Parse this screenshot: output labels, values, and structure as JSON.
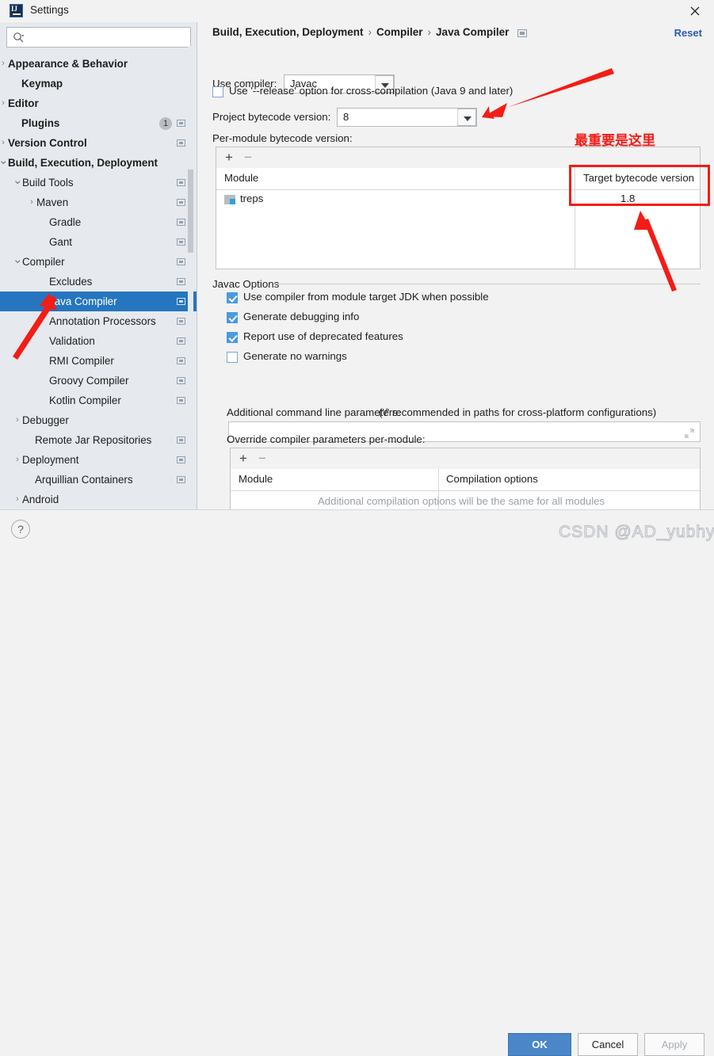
{
  "window": {
    "title": "Settings",
    "logo_icon": "intellij-idea-logo",
    "close_icon": "close-icon"
  },
  "search": {
    "value": "",
    "placeholder": "",
    "icon": "search-icon"
  },
  "sidebar": {
    "items": [
      {
        "label": "Appearance & Behavior",
        "indent": 10,
        "arrow": "chevron-right",
        "bold": true,
        "cfg": false,
        "badge": null,
        "selected": false
      },
      {
        "label": "Keymap",
        "indent": 27,
        "arrow": "",
        "bold": true,
        "cfg": false,
        "badge": null,
        "selected": false
      },
      {
        "label": "Editor",
        "indent": 10,
        "arrow": "chevron-right",
        "bold": true,
        "cfg": false,
        "badge": null,
        "selected": false
      },
      {
        "label": "Plugins",
        "indent": 27,
        "arrow": "",
        "bold": true,
        "cfg": true,
        "badge": "1",
        "selected": false
      },
      {
        "label": "Version Control",
        "indent": 10,
        "arrow": "chevron-right",
        "bold": true,
        "cfg": true,
        "badge": null,
        "selected": false
      },
      {
        "label": "Build, Execution, Deployment",
        "indent": 10,
        "arrow": "chevron-down",
        "bold": true,
        "cfg": false,
        "badge": null,
        "selected": false
      },
      {
        "label": "Build Tools",
        "indent": 28,
        "arrow": "chevron-down",
        "bold": false,
        "cfg": true,
        "badge": null,
        "selected": false
      },
      {
        "label": "Maven",
        "indent": 46,
        "arrow": "chevron-right",
        "bold": false,
        "cfg": true,
        "badge": null,
        "selected": false
      },
      {
        "label": "Gradle",
        "indent": 62,
        "arrow": "",
        "bold": false,
        "cfg": true,
        "badge": null,
        "selected": false
      },
      {
        "label": "Gant",
        "indent": 62,
        "arrow": "",
        "bold": false,
        "cfg": true,
        "badge": null,
        "selected": false
      },
      {
        "label": "Compiler",
        "indent": 28,
        "arrow": "chevron-down",
        "bold": false,
        "cfg": true,
        "badge": null,
        "selected": false
      },
      {
        "label": "Excludes",
        "indent": 62,
        "arrow": "",
        "bold": false,
        "cfg": true,
        "badge": null,
        "selected": false
      },
      {
        "label": "Java Compiler",
        "indent": 62,
        "arrow": "",
        "bold": false,
        "cfg": true,
        "badge": null,
        "selected": true
      },
      {
        "label": "Annotation Processors",
        "indent": 62,
        "arrow": "",
        "bold": false,
        "cfg": true,
        "badge": null,
        "selected": false
      },
      {
        "label": "Validation",
        "indent": 62,
        "arrow": "",
        "bold": false,
        "cfg": true,
        "badge": null,
        "selected": false
      },
      {
        "label": "RMI Compiler",
        "indent": 62,
        "arrow": "",
        "bold": false,
        "cfg": true,
        "badge": null,
        "selected": false
      },
      {
        "label": "Groovy Compiler",
        "indent": 62,
        "arrow": "",
        "bold": false,
        "cfg": true,
        "badge": null,
        "selected": false
      },
      {
        "label": "Kotlin Compiler",
        "indent": 62,
        "arrow": "",
        "bold": false,
        "cfg": true,
        "badge": null,
        "selected": false
      },
      {
        "label": "Debugger",
        "indent": 28,
        "arrow": "chevron-right",
        "bold": false,
        "cfg": false,
        "badge": null,
        "selected": false
      },
      {
        "label": "Remote Jar Repositories",
        "indent": 44,
        "arrow": "",
        "bold": false,
        "cfg": true,
        "badge": null,
        "selected": false
      },
      {
        "label": "Deployment",
        "indent": 28,
        "arrow": "chevron-right",
        "bold": false,
        "cfg": true,
        "badge": null,
        "selected": false
      },
      {
        "label": "Arquillian Containers",
        "indent": 44,
        "arrow": "",
        "bold": false,
        "cfg": true,
        "badge": null,
        "selected": false
      },
      {
        "label": "Android",
        "indent": 28,
        "arrow": "chevron-right",
        "bold": false,
        "cfg": false,
        "badge": null,
        "selected": false
      }
    ]
  },
  "panel": {
    "breadcrumb": {
      "part1": "Build, Execution, Deployment",
      "sep1": "›",
      "part2": "Compiler",
      "sep2": "›",
      "part3": "Java Compiler",
      "icon": "module-settings-icon"
    },
    "reset_label": "Reset",
    "use_compiler_label": "Use compiler:",
    "use_compiler_value": "Javac",
    "release_option_label": "Use '--release' option for cross-compilation (Java 9 and later)",
    "release_option_checked": false,
    "project_bytecode_label": "Project bytecode version:",
    "project_bytecode_value": "8",
    "per_module_label": "Per-module bytecode version:",
    "module_table": {
      "add_icon": "+",
      "remove_icon": "−",
      "columns": [
        "Module",
        "Target bytecode version"
      ],
      "rows": [
        {
          "module": "treps",
          "module_icon": "module-folder-icon",
          "target": "1.8"
        }
      ]
    },
    "javac_options_label": "Javac Options",
    "javac_checkboxes": [
      {
        "label": "Use compiler from module target JDK when possible",
        "checked": true
      },
      {
        "label": "Generate debugging info",
        "checked": true
      },
      {
        "label": "Report use of deprecated features",
        "checked": true
      },
      {
        "label": "Generate no warnings",
        "checked": false
      }
    ],
    "additional_params_label": "Additional command line parameters:",
    "additional_params_hint": "('/' recommended in paths for cross-platform configurations)",
    "additional_params_value": "",
    "expand_icon": "expand-icon",
    "override_label": "Override compiler parameters per-module:",
    "override_table": {
      "add_icon": "+",
      "remove_icon": "−",
      "columns": [
        "Module",
        "Compilation options"
      ],
      "empty_text": "Additional compilation options will be the same for all modules"
    }
  },
  "footer": {
    "help_icon": "?",
    "ok_label": "OK",
    "cancel_label": "Cancel",
    "apply_label": "Apply"
  },
  "annotations": {
    "chinese_note": "最重要是这里",
    "watermark": "CSDN @AD_yubhyu",
    "accent_red": "#f41c16",
    "accent_blue": "#2675bf"
  }
}
